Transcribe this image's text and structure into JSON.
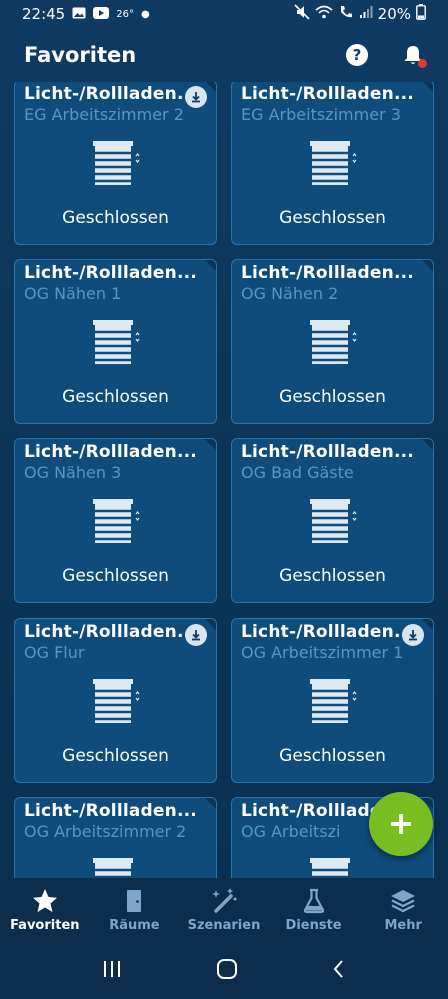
{
  "status_bar": {
    "time": "22:45",
    "temp": "26°",
    "battery": "20%"
  },
  "header": {
    "title": "Favoriten"
  },
  "tiles": [
    {
      "name": "Licht-/Rollladen...",
      "room": "EG Arbeitszimmer 2",
      "status": "Geschlossen"
    },
    {
      "name": "Licht-/Rollladen...",
      "room": "EG Arbeitszimmer 3",
      "status": "Geschlossen"
    },
    {
      "name": "Licht-/Rollladen...",
      "room": "OG Nähen 1",
      "status": "Geschlossen"
    },
    {
      "name": "Licht-/Rollladen...",
      "room": "OG Nähen 2",
      "status": "Geschlossen"
    },
    {
      "name": "Licht-/Rollladen...",
      "room": "OG Nähen 3",
      "status": "Geschlossen"
    },
    {
      "name": "Licht-/Rollladen...",
      "room": "OG Bad Gäste",
      "status": "Geschlossen"
    },
    {
      "name": "Licht-/Rollladen...",
      "room": "OG Flur",
      "status": "Geschlossen"
    },
    {
      "name": "Licht-/Rollladen...",
      "room": "OG Arbeitszimmer 1",
      "status": "Geschlossen"
    },
    {
      "name": "Licht-/Rollladen...",
      "room": "OG Arbeitszimmer 2",
      "status": ""
    },
    {
      "name": "Licht-/Rollladen",
      "room": "OG Arbeitszi",
      "status": ""
    }
  ],
  "nav": {
    "items": [
      {
        "label": "Favoriten",
        "icon": "star-icon"
      },
      {
        "label": "Räume",
        "icon": "door-icon"
      },
      {
        "label": "Szenarien",
        "icon": "magic-wand-icon"
      },
      {
        "label": "Dienste",
        "icon": "flask-icon"
      },
      {
        "label": "Mehr",
        "icon": "layers-icon"
      }
    ]
  },
  "colors": {
    "accent_green": "#78be20",
    "tile_bg": "#0f4c7c",
    "muted_text": "#5e93bd"
  }
}
